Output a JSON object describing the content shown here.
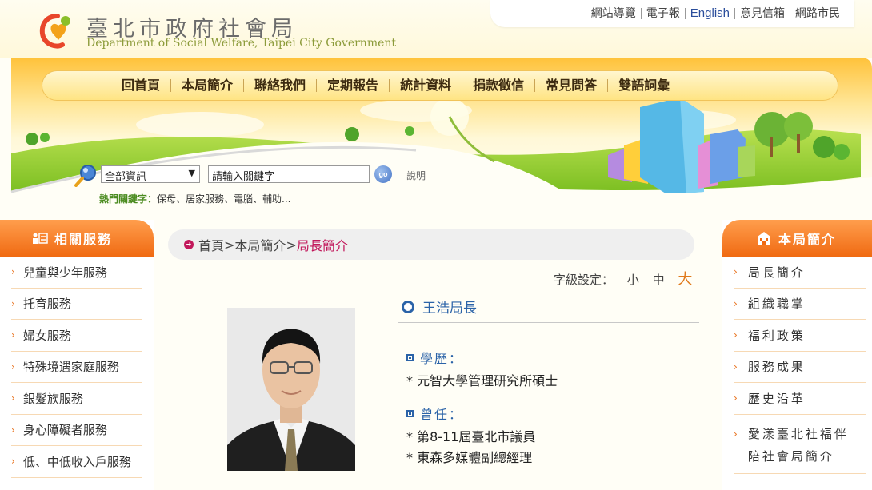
{
  "header": {
    "logo_zh": "臺北市政府社會局",
    "logo_en": "Department of Social Welfare, Taipei City Government",
    "top_links": [
      "網站導覽",
      "電子報",
      "English",
      "意見信箱",
      "網路市民"
    ]
  },
  "nav": [
    "回首頁",
    "本局簡介",
    "聯絡我們",
    "定期報告",
    "統計資料",
    "捐款徵信",
    "常見問答",
    "雙語詞彙"
  ],
  "search": {
    "scope": "全部資訊",
    "keyword": "請輸入關鍵字",
    "go_label": "go",
    "help": "說明",
    "hot_label": "熱門關鍵字：",
    "hot_keywords": "保母、居家服務、電腦、輔助..."
  },
  "left_sidebar": {
    "title": "相關服務",
    "items": [
      "兒童與少年服務",
      "托育服務",
      "婦女服務",
      "特殊境遇家庭服務",
      "銀髮族服務",
      "身心障礙者服務",
      "低、中低收入戶服務"
    ]
  },
  "right_sidebar": {
    "title": "本局簡介",
    "items": [
      "局長簡介",
      "組織職掌",
      "福利政策",
      "服務成果",
      "歷史沿革",
      "愛漾臺北社福伴陪社會局簡介"
    ]
  },
  "breadcrumb": {
    "home": "首頁",
    "sep1": ">",
    "section": "本局簡介",
    "sep2": ">",
    "current": "局長簡介"
  },
  "font_size": {
    "label": "字級設定：",
    "small": "小",
    "medium": "中",
    "large": "大"
  },
  "profile": {
    "name": "王浩局長",
    "education_title": "學歷：",
    "education": [
      "* 元智大學管理研究所碩士"
    ],
    "experience_title": "曾任：",
    "experience": [
      "* 第8-11屆臺北市議員",
      "* 東森多媒體副總經理"
    ]
  },
  "colors": {
    "accent_orange": "#f06a12",
    "link_blue": "#2b63a8",
    "breadcrumb_current": "#c2185b"
  }
}
